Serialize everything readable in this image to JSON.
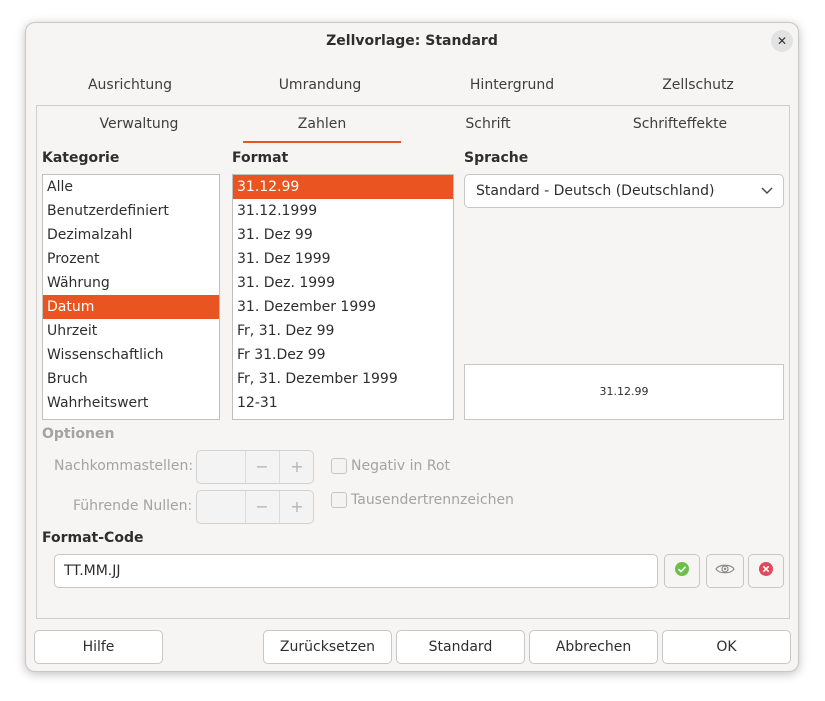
{
  "dialog": {
    "title": "Zellvorlage: Standard",
    "close_symbol": "✕"
  },
  "tabs_row1": [
    "Ausrichtung",
    "Umrandung",
    "Hintergrund",
    "Zellschutz"
  ],
  "tabs_row2": [
    "Verwaltung",
    "Zahlen",
    "Schrift",
    "Schrifteffekte"
  ],
  "active_tab": "Zahlen",
  "kategorie": {
    "label": "Kategorie",
    "items": [
      "Alle",
      "Benutzerdefiniert",
      "Dezimalzahl",
      "Prozent",
      "Währung",
      "Datum",
      "Uhrzeit",
      "Wissenschaftlich",
      "Bruch",
      "Wahrheitswert"
    ],
    "selected": "Datum"
  },
  "format": {
    "label": "Format",
    "items": [
      "31.12.99",
      "31.12.1999",
      "31. Dez 99",
      "31. Dez 1999",
      "31. Dez. 1999",
      "31. Dezember 1999",
      "Fr, 31. Dez 99",
      "Fr 31.Dez 99",
      "Fr, 31. Dezember 1999",
      "12-31"
    ],
    "selected": "31.12.99"
  },
  "sprache": {
    "label": "Sprache",
    "value": "Standard - Deutsch (Deutschland)"
  },
  "preview_text": "31.12.99",
  "optionen": {
    "label": "Optionen",
    "nachkommastellen_label": "Nachkommastellen:",
    "fuehrende_nullen_label": "Führende Nullen:",
    "negativ_in_rot_label": "Negativ in Rot",
    "tausendertrennzeichen_label": "Tausendertrennzeichen",
    "minus_symbol": "−",
    "plus_symbol": "+"
  },
  "format_code": {
    "label": "Format-Code",
    "value": "TT.MM.JJ"
  },
  "buttons": {
    "hilfe": "Hilfe",
    "zuruecksetzen": "Zurücksetzen",
    "standard": "Standard",
    "abbrechen": "Abbrechen",
    "ok": "OK"
  },
  "colors": {
    "accent": "#e95420",
    "ok_green": "#6cc04a",
    "remove_red": "#e04b5a"
  }
}
